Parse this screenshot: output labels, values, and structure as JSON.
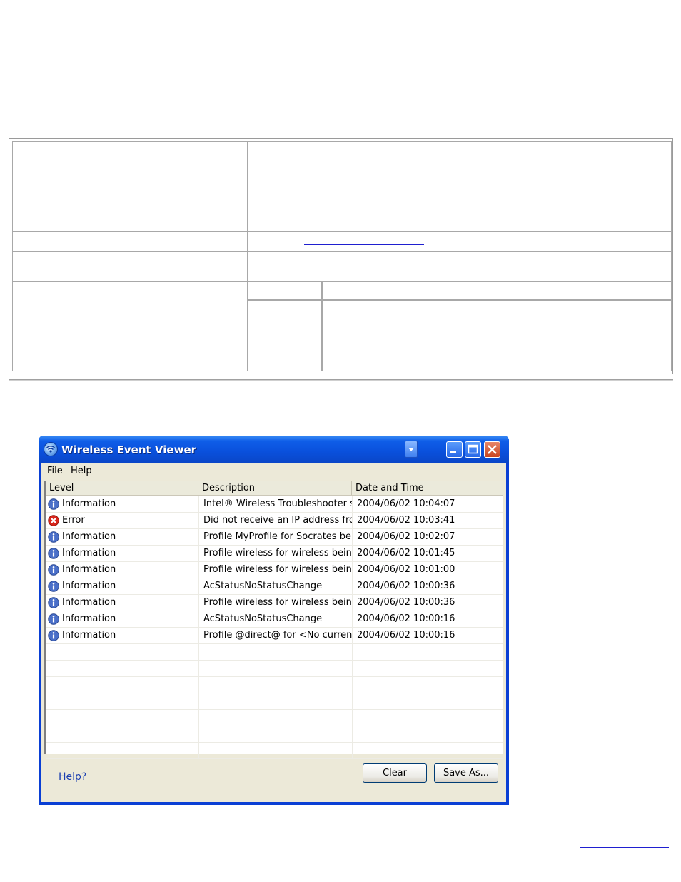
{
  "window": {
    "title": "Wireless Event Viewer",
    "menu": [
      "File",
      "Help"
    ],
    "columns": [
      "Level",
      "Description",
      "Date and Time"
    ],
    "rows": [
      {
        "level": "Information",
        "type": "info",
        "description": "Intel® Wireless Troubleshooter s...",
        "datetime": "2004/06/02 10:04:07"
      },
      {
        "level": "Error",
        "type": "error",
        "description": "Did not receive an IP address fro...",
        "datetime": "2004/06/02 10:03:41"
      },
      {
        "level": "Information",
        "type": "info",
        "description": "Profile MyProfile for Socrates bei...",
        "datetime": "2004/06/02 10:02:07"
      },
      {
        "level": "Information",
        "type": "info",
        "description": "Profile wireless for wireless being ...",
        "datetime": "2004/06/02 10:01:45"
      },
      {
        "level": "Information",
        "type": "info",
        "description": "Profile wireless for wireless being ...",
        "datetime": "2004/06/02 10:01:00"
      },
      {
        "level": "Information",
        "type": "info",
        "description": "AcStatusNoStatusChange",
        "datetime": "2004/06/02 10:00:36"
      },
      {
        "level": "Information",
        "type": "info",
        "description": "Profile wireless for wireless being ...",
        "datetime": "2004/06/02 10:00:36"
      },
      {
        "level": "Information",
        "type": "info",
        "description": "AcStatusNoStatusChange",
        "datetime": "2004/06/02 10:00:16"
      },
      {
        "level": "Information",
        "type": "info",
        "description": "Profile @direct@ for <No current ...",
        "datetime": "2004/06/02 10:00:16"
      }
    ],
    "empty_rows": 7,
    "help_link": "Help?",
    "clear_button": "Clear",
    "save_button": "Save As..."
  },
  "colors": {
    "title_bar": "#0a50dc",
    "error_icon": "#d8261c",
    "info_icon": "#4a6fc8",
    "link": "#1f1fd0"
  }
}
